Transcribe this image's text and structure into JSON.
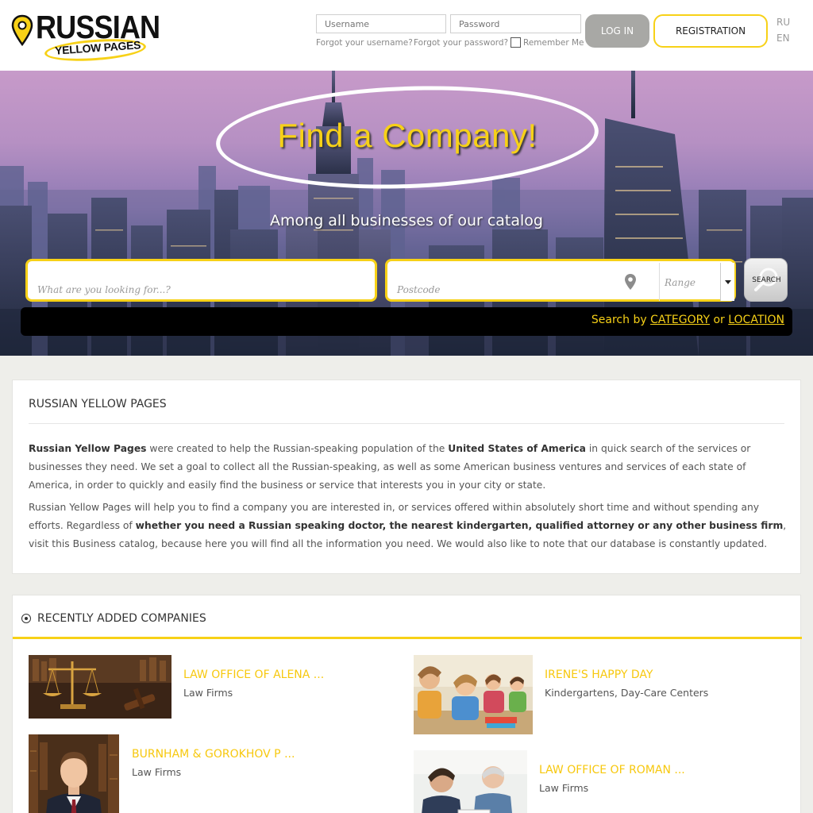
{
  "header": {
    "logo_main": "RUSSIAN",
    "logo_sub": "YELLOW PAGES",
    "username_placeholder": "Username",
    "password_placeholder": "Password",
    "forgot_username": "Forgot your username?",
    "forgot_password": "Forgot your password?",
    "remember_me": "Remember Me",
    "login_label": "LOG IN",
    "registration_label": "REGISTRATION",
    "lang_ru": "RU",
    "lang_en": "EN"
  },
  "hero": {
    "title": "Find a Company!",
    "subtitle": "Among all businesses of our catalog",
    "what_placeholder": "What are you looking for...?",
    "postcode_placeholder": "Postcode",
    "range_placeholder": "Range",
    "search_label": "SEARCH",
    "search_by_prefix": "Search by",
    "search_by_category": "CATEGORY",
    "search_by_or": "or",
    "search_by_location": "LOCATION"
  },
  "about": {
    "title": "RUSSIAN YELLOW PAGES",
    "p1_b1": "Russian Yellow Pages",
    "p1_t1": " were created to help the Russian-speaking population of the ",
    "p1_b2": "United States of America",
    "p1_t2": " in quick search of the services or businesses they need. We set a goal to collect all the Russian-speaking, as well as some American business ventures and services of each state of America, in order to quickly and easily find the business or service that interests you in your city or state.",
    "p2_t1": "Russian Yellow Pages will help you to find a company you are interested in, or services offered within absolutely short time and without spending any efforts. Regardless of ",
    "p2_b1": "whether you need a Russian speaking doctor, the nearest kindergarten, qualified attorney or any other business firm",
    "p2_t2": ", visit this Business catalog, because here you will find all the information you need. We would also like to note that our database is constantly updated."
  },
  "recent": {
    "title": "RECENTLY ADDED COMPANIES",
    "companies": [
      {
        "name": "LAW OFFICE OF ALENA ...",
        "category": "Law Firms"
      },
      {
        "name": "IRENE'S HAPPY DAY",
        "category": "Kindergartens, Day-Care Centers"
      },
      {
        "name": "BURNHAM & GOROKHOV P ...",
        "category": "Law Firms"
      },
      {
        "name": "LAW OFFICE OF ROMAN ...",
        "category": "Law Firms"
      }
    ]
  },
  "colors": {
    "accent_yellow": "#f7d117",
    "login_gray": "#a8a8a5",
    "search_bar_black": "#000000"
  }
}
